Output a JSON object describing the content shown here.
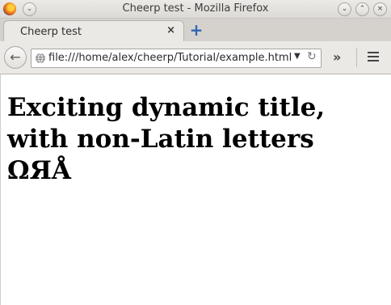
{
  "window": {
    "title": "Cheerp test - Mozilla Firefox"
  },
  "tabs": [
    {
      "label": "Cheerp test",
      "close_glyph": "×"
    }
  ],
  "new_tab_glyph": "+",
  "navbar": {
    "back_glyph": "←",
    "url": "file:///home/alex/cheerp/Tutorial/example.html",
    "dropdown_glyph": "▼",
    "reload_glyph": "↻",
    "overflow_glyph": "»"
  },
  "window_buttons": {
    "minimize_glyph": "⌄",
    "maximize_glyph": "⌃",
    "close_glyph": "×",
    "menu_glyph": "⌄"
  },
  "page": {
    "heading": "Exciting dynamic title, with non-Latin letters ΩЯÅ"
  }
}
